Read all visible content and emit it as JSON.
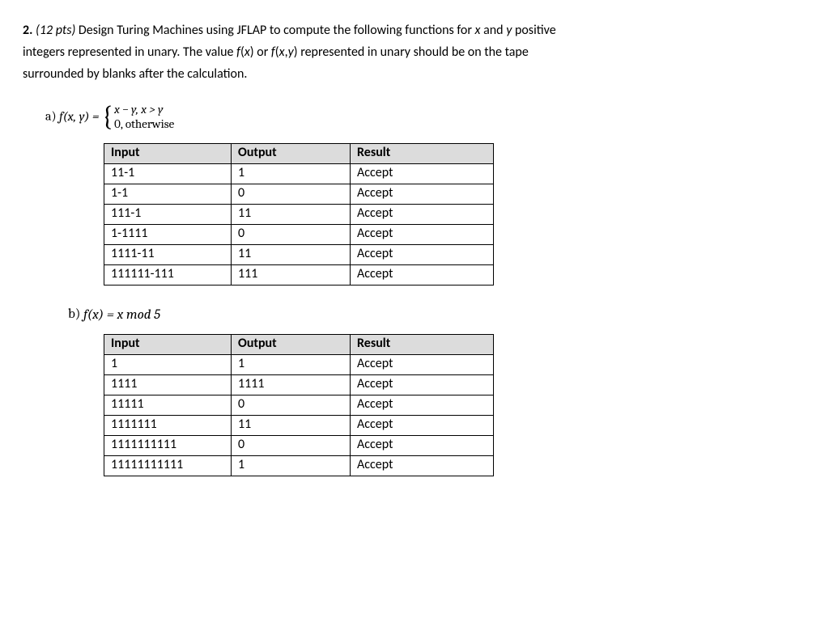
{
  "question_num": "2.",
  "points": "(12 pts)",
  "intro_l1a": " Design Turing Machines using JFLAP to compute the following functions for ",
  "intro_x": "x",
  "intro_and": " and ",
  "intro_y": "y",
  "intro_l1b": " positive",
  "intro_l2a": "integers represented in unary. The value ",
  "intro_fx": "f",
  "intro_fx2": "(",
  "intro_fx3": "x",
  "intro_fx4": ")",
  "intro_or": " or ",
  "intro_fxy": "f",
  "intro_fxy2": "(",
  "intro_fxy3": "x",
  "intro_fxy4": ",",
  "intro_fxy5": "y",
  "intro_fxy6": ")",
  "intro_l2b": " represented in unary should be on the tape",
  "intro_l3": "surrounded by blanks after the calculation.",
  "part_a_label": "a)   ",
  "part_a_func": "f(x, y) = ",
  "case1": "x − y,  x > y",
  "case2": "0,  otherwise",
  "headers": {
    "input": "Input",
    "output": "Output",
    "result": "Result"
  },
  "table_a": [
    {
      "input": "11-1",
      "output": "1",
      "result": "Accept"
    },
    {
      "input": "1-1",
      "output": "0",
      "result": "Accept"
    },
    {
      "input": "111-1",
      "output": "11",
      "result": "Accept"
    },
    {
      "input": "1-1111",
      "output": "0",
      "result": "Accept"
    },
    {
      "input": "1111-11",
      "output": "11",
      "result": "Accept"
    },
    {
      "input": "111111-111",
      "output": "111",
      "result": "Accept"
    }
  ],
  "part_b_label": "b)   ",
  "part_b_func": "f(x) = x mod 5",
  "table_b": [
    {
      "input": "1",
      "output": "1",
      "result": "Accept"
    },
    {
      "input": "1111",
      "output": "1111",
      "result": "Accept"
    },
    {
      "input": "11111",
      "output": "0",
      "result": "Accept"
    },
    {
      "input": "1111111",
      "output": "11",
      "result": "Accept"
    },
    {
      "input": "1111111111",
      "output": "0",
      "result": "Accept"
    },
    {
      "input": "11111111111",
      "output": "1",
      "result": "Accept"
    }
  ]
}
